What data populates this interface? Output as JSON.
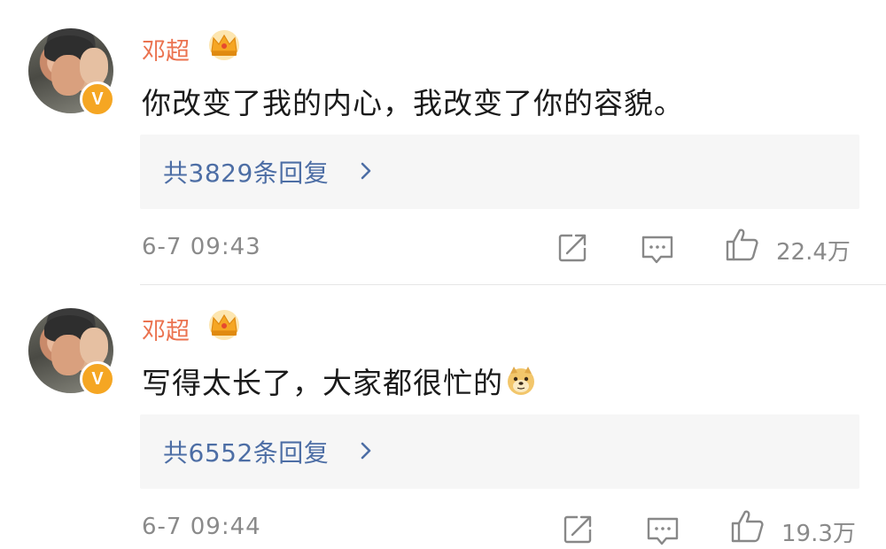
{
  "comments": [
    {
      "username": "邓超",
      "badge": "V",
      "text": "你改变了我的内心，我改变了你的容貌。",
      "reply_link": "共3829条回复",
      "timestamp": "6-7 09:43",
      "likes": "22.4万"
    },
    {
      "username": "邓超",
      "badge": "V",
      "text": "写得太长了，大家都很忙的",
      "emoji": "doge-emoji",
      "reply_link": "共6552条回复",
      "timestamp": "6-7 09:44",
      "likes": "19.3万"
    }
  ],
  "icons": {
    "share": "share-icon",
    "comment": "comment-icon",
    "like": "thumbs-up-icon",
    "crown": "crown-icon",
    "chevron": "chevron-right-icon"
  },
  "colors": {
    "username": "#eb7350",
    "reply_link": "#4d6ea5",
    "meta_gray": "#8a8a8a",
    "reply_bg": "#f6f6f6",
    "verified_badge": "#f5a623",
    "crown": "#f5a623"
  }
}
